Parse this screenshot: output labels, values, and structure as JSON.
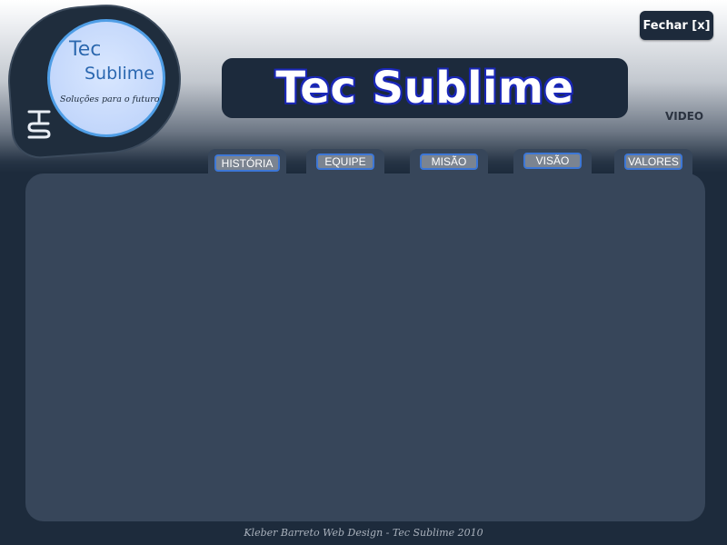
{
  "logo": {
    "line1": "Tec",
    "line2": "Sublime",
    "slogan": "Soluções para o futuro !",
    "mark_icon": "ts-monogram-icon"
  },
  "header": {
    "close_label": "Fechar [x]",
    "title": "Tec Sublime",
    "video_label": "VIDEO"
  },
  "tabs": [
    {
      "label": "HISTÓRIA"
    },
    {
      "label": "EQUIPE"
    },
    {
      "label": "MISÃO"
    },
    {
      "label": "VISÃO"
    },
    {
      "label": "VALORES"
    }
  ],
  "footer": {
    "credit": "Kleber Barreto Web Design - Tec Sublime 2010"
  },
  "colors": {
    "panel": "#37465a",
    "dark_navy": "#1d2b3c",
    "accent_blue": "#3d77d6",
    "title_outline": "#1a27b8"
  }
}
